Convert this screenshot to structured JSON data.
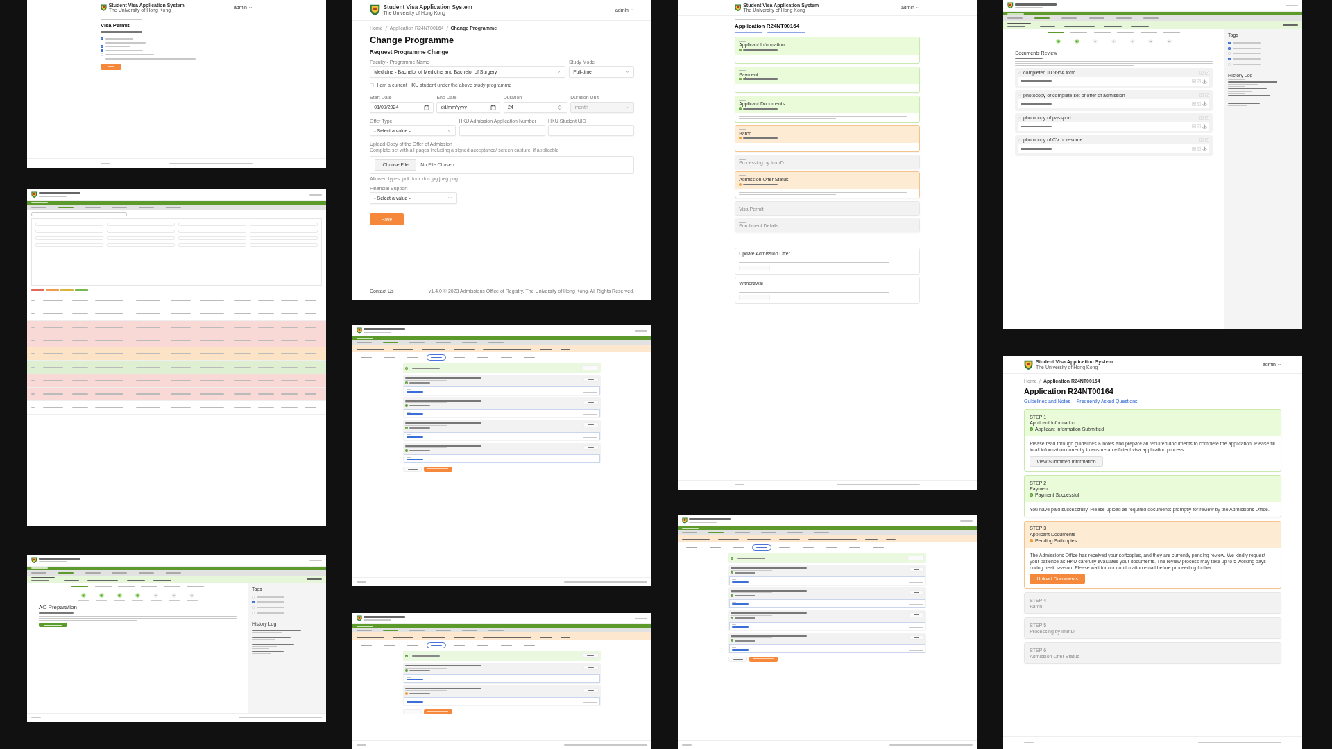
{
  "columns": [
    {
      "screens": [
        {
          "kind": "visa_permit",
          "header": {
            "title": "Student Visa Application System",
            "subtitle": "The University of Hong Kong",
            "user": "admin"
          },
          "title": "Visa Permit",
          "checks": [
            {
              "checked": true
            },
            {
              "checked": false
            },
            {
              "checked": true
            },
            {
              "checked": true
            },
            {
              "checked": false
            },
            {
              "checked": false
            }
          ]
        },
        {
          "kind": "staff_list",
          "legend": [
            {
              "color": "#e2675c"
            },
            {
              "color": "#ef9c4f"
            },
            {
              "color": "#d9b53e"
            },
            {
              "color": "#76b84f"
            }
          ],
          "rows": [
            {
              "color": "#ffffff"
            },
            {
              "color": "#ffffff"
            },
            {
              "color": "#f8d9d6"
            },
            {
              "color": "#f8d9d6"
            },
            {
              "color": "#fde3c6"
            },
            {
              "color": "#dff0d2"
            },
            {
              "color": "#f8d9d6"
            },
            {
              "color": "#f8d9d6"
            },
            {
              "color": "#ffffff"
            }
          ]
        },
        {
          "kind": "ao_prep",
          "stepper": [
            {
              "done": true
            },
            {
              "done": true
            },
            {
              "done": true
            },
            {
              "done": true
            },
            {
              "done": false
            },
            {
              "done": false
            },
            {
              "done": false
            }
          ],
          "title": "AO Preparation",
          "tags_title": "Tags",
          "tags": [
            {
              "checked": false
            },
            {
              "checked": true
            },
            {
              "checked": false
            },
            {
              "checked": false
            }
          ],
          "history_title": "History Log"
        }
      ]
    },
    {
      "screens": [
        {
          "kind": "change_programme",
          "header": {
            "title": "Student Visa Application System",
            "subtitle": "The University of Hong Kong",
            "user": "admin"
          },
          "breadcrumb": [
            "Home",
            "Application R24NT00164",
            "Change Programme"
          ],
          "title": "Change Programme",
          "section": "Request Programme Change",
          "rows": [
            {
              "fields": [
                {
                  "kind": "select",
                  "label": "Faculty - Programme Name",
                  "value": "Medicine - Bachelor of Medicine and Bachelor of Surgery"
                },
                {
                  "kind": "select",
                  "label": "Study Mode",
                  "value": "Full-time"
                }
              ]
            },
            {
              "fields": [
                {
                  "kind": "date",
                  "label": "Start Date",
                  "value": "01/09/2024"
                },
                {
                  "kind": "date",
                  "label": "End Date",
                  "placeholder": "dd/mm/yyyy"
                },
                {
                  "kind": "number",
                  "label": "Duration",
                  "value": "24"
                },
                {
                  "kind": "select",
                  "label": "Duration Unit",
                  "placeholder": "month",
                  "disabled": true
                }
              ]
            },
            {
              "fields": [
                {
                  "kind": "select",
                  "label": "Offer Type",
                  "placeholder": "- Select a value -"
                },
                {
                  "kind": "text",
                  "label": "HKU Admission Application Number"
                },
                {
                  "kind": "text",
                  "label": "HKU Student UID"
                }
              ]
            }
          ],
          "confirm": {
            "label": "I am a current HKU student under the above study programme",
            "checked": false
          },
          "upload": {
            "label": "Upload Copy of the Offer of Admission",
            "hint": "Complete set with all pages including a signed acceptance/ screen capture, if applicable",
            "button": "Choose File",
            "file": "No File Chosen",
            "note": "Allowed types: pdf docx doc jpg jpeg png"
          },
          "financial": {
            "kind": "select",
            "label": "Financial Support",
            "placeholder": "- Select a value -"
          },
          "button": "Save",
          "footer": {
            "link": "Contact Us",
            "copyright": "v1.4.0  © 2023 Admissions Office of Registry, The University of Hong Kong. All Rights Reserved."
          }
        },
        {
          "kind": "doc_detail",
          "subtabs": [
            {
              "selected": false
            },
            {
              "selected": false
            },
            {
              "selected": false
            },
            {
              "selected": true
            },
            {
              "selected": false
            },
            {
              "selected": false
            },
            {
              "selected": false
            },
            {
              "selected": false
            }
          ],
          "documents": [
            {
              "done": true
            },
            {
              "done": true
            },
            {
              "done": true
            },
            {
              "done": true
            }
          ]
        },
        {
          "kind": "doc_detail",
          "subtabs": [
            {
              "selected": false
            },
            {
              "selected": false
            },
            {
              "selected": false
            },
            {
              "selected": true
            },
            {
              "selected": false
            },
            {
              "selected": false
            },
            {
              "selected": false
            },
            {
              "selected": false
            }
          ],
          "documents": [
            {
              "done": true
            },
            {
              "done": false
            }
          ]
        }
      ]
    },
    {
      "screens": [
        {
          "kind": "steps",
          "header": {
            "title": "Student Visa Application System",
            "subtitle": "The University of Hong Kong",
            "user": "admin"
          },
          "title": "Application R24NT00164",
          "steps": [
            {
              "kind": "done",
              "title": "Applicant Information"
            },
            {
              "kind": "done",
              "title": "Payment"
            },
            {
              "kind": "done",
              "title": "Applicant Documents"
            },
            {
              "kind": "pending",
              "title": "Batch"
            },
            {
              "kind": "locked",
              "title": "Processing by ImmD"
            },
            {
              "kind": "pending",
              "title": "Admission Offer Status"
            },
            {
              "kind": "locked",
              "title": "Visa Permit"
            },
            {
              "kind": "locked",
              "title": "Enrollment Details"
            }
          ],
          "extras": [
            {
              "title": "Update Admission Offer"
            },
            {
              "title": "Withdrawal"
            }
          ]
        },
        {
          "kind": "doc_detail",
          "subtabs": [
            {
              "selected": false
            },
            {
              "selected": false
            },
            {
              "selected": false
            },
            {
              "selected": true
            },
            {
              "selected": false
            },
            {
              "selected": false
            },
            {
              "selected": false
            },
            {
              "selected": false
            },
            {
              "selected": false
            }
          ],
          "documents": [
            {
              "done": true
            },
            {
              "done": true
            },
            {
              "done": true
            },
            {
              "done": true
            }
          ]
        }
      ]
    },
    {
      "screens": [
        {
          "kind": "docs_review",
          "stepper": [
            {
              "done": true
            },
            {
              "done": true
            },
            {
              "done": false
            },
            {
              "done": false
            },
            {
              "done": false
            },
            {
              "done": false
            },
            {
              "done": false
            }
          ],
          "title": "Documents Review",
          "groups": [
            {
              "title": "completed ID 995A form"
            },
            {
              "title": "photocopy of complete set of offer of admission"
            },
            {
              "title": "photocopy of passport"
            },
            {
              "title": "photocopy of CV or resume"
            }
          ],
          "tags_title": "Tags",
          "tags": [
            {
              "checked": true
            },
            {
              "checked": true
            },
            {
              "checked": false
            },
            {
              "checked": true
            },
            {
              "checked": false
            }
          ],
          "history_title": "History Log"
        },
        {
          "kind": "steps",
          "header": {
            "title": "Student Visa Application System",
            "subtitle": "The University of Hong Kong",
            "user": "admin"
          },
          "breadcrumb": [
            "Home",
            "Application R24NT00164"
          ],
          "title": "Application R24NT00164",
          "links": [
            "Guidelines and Notes",
            "Frequently Asked Questions"
          ],
          "steps": [
            {
              "kind": "done",
              "label": "STEP 1",
              "title": "Applicant Information",
              "status_text": "Applicant Information Submitted",
              "body": "Please read through guidelines & notes and prepare all required documents to complete the application. Please fill in all information correctly to ensure an efficient visa application process.",
              "button": "View Submitted Information",
              "primary": false
            },
            {
              "kind": "done",
              "label": "STEP 2",
              "title": "Payment",
              "status_text": "Payment Successful",
              "body": "You have paid successfully. Please upload all required documents promptly for review by the Admissions Office."
            },
            {
              "kind": "pending",
              "label": "STEP 3",
              "title": "Applicant Documents",
              "status_text": "Pending Softcopies",
              "body": "The Admissions Office has received your softcopies, and they are currently pending review. We kindly request your patience as HKU carefully evaluates your documents. The review process may take up to 5 working days during peak season. Please wait for our confirmation email before proceeding further.",
              "button": "Upload Documents",
              "primary": true
            },
            {
              "kind": "locked",
              "label": "STEP 4",
              "title": "Batch"
            },
            {
              "kind": "locked",
              "label": "STEP 5",
              "title": "Processing by ImmD"
            },
            {
              "kind": "locked",
              "label": "STEP 6",
              "title": "Admission Offer Status"
            }
          ]
        }
      ]
    }
  ]
}
